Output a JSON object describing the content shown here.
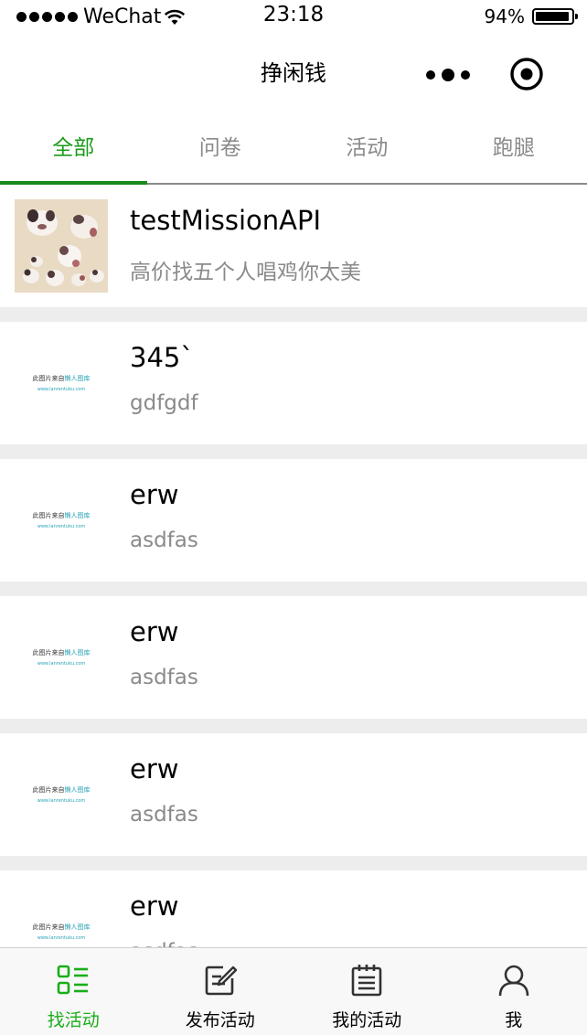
{
  "status_bar": {
    "carrier": "WeChat",
    "time": "23:18",
    "battery_percent_text": "94%",
    "battery_level": 0.94
  },
  "nav": {
    "title": "挣闲钱"
  },
  "tabs": [
    {
      "label": "全部",
      "active": true
    },
    {
      "label": "问卷",
      "active": false
    },
    {
      "label": "活动",
      "active": false
    },
    {
      "label": "跑腿",
      "active": false
    }
  ],
  "items": [
    {
      "title": "testMissionAPI",
      "subtitle": "高价找五个人唱鸡你太美",
      "thumbnail": "photo"
    },
    {
      "title": "345`",
      "subtitle": "gdfgdf",
      "thumbnail": "placeholder"
    },
    {
      "title": "erw",
      "subtitle": "asdfas",
      "thumbnail": "placeholder"
    },
    {
      "title": "erw",
      "subtitle": "asdfas",
      "thumbnail": "placeholder"
    },
    {
      "title": "erw",
      "subtitle": "asdfas",
      "thumbnail": "placeholder"
    },
    {
      "title": "erw",
      "subtitle": "asdfas",
      "thumbnail": "placeholder"
    }
  ],
  "placeholder_image": {
    "line1_a": "此图片来自",
    "line1_b": "懒人图库",
    "line2": "www.lanrentuku.com"
  },
  "bottom_tabs": [
    {
      "label": "找活动",
      "icon": "list-icon",
      "active": true
    },
    {
      "label": "发布活动",
      "icon": "edit-icon",
      "active": false
    },
    {
      "label": "我的活动",
      "icon": "calendar-icon",
      "active": false
    },
    {
      "label": "我",
      "icon": "person-icon",
      "active": false
    }
  ],
  "colors": {
    "accent_green": "#1aad19",
    "tab_text_gray": "#8a8a8a",
    "separator": "#ededed"
  }
}
